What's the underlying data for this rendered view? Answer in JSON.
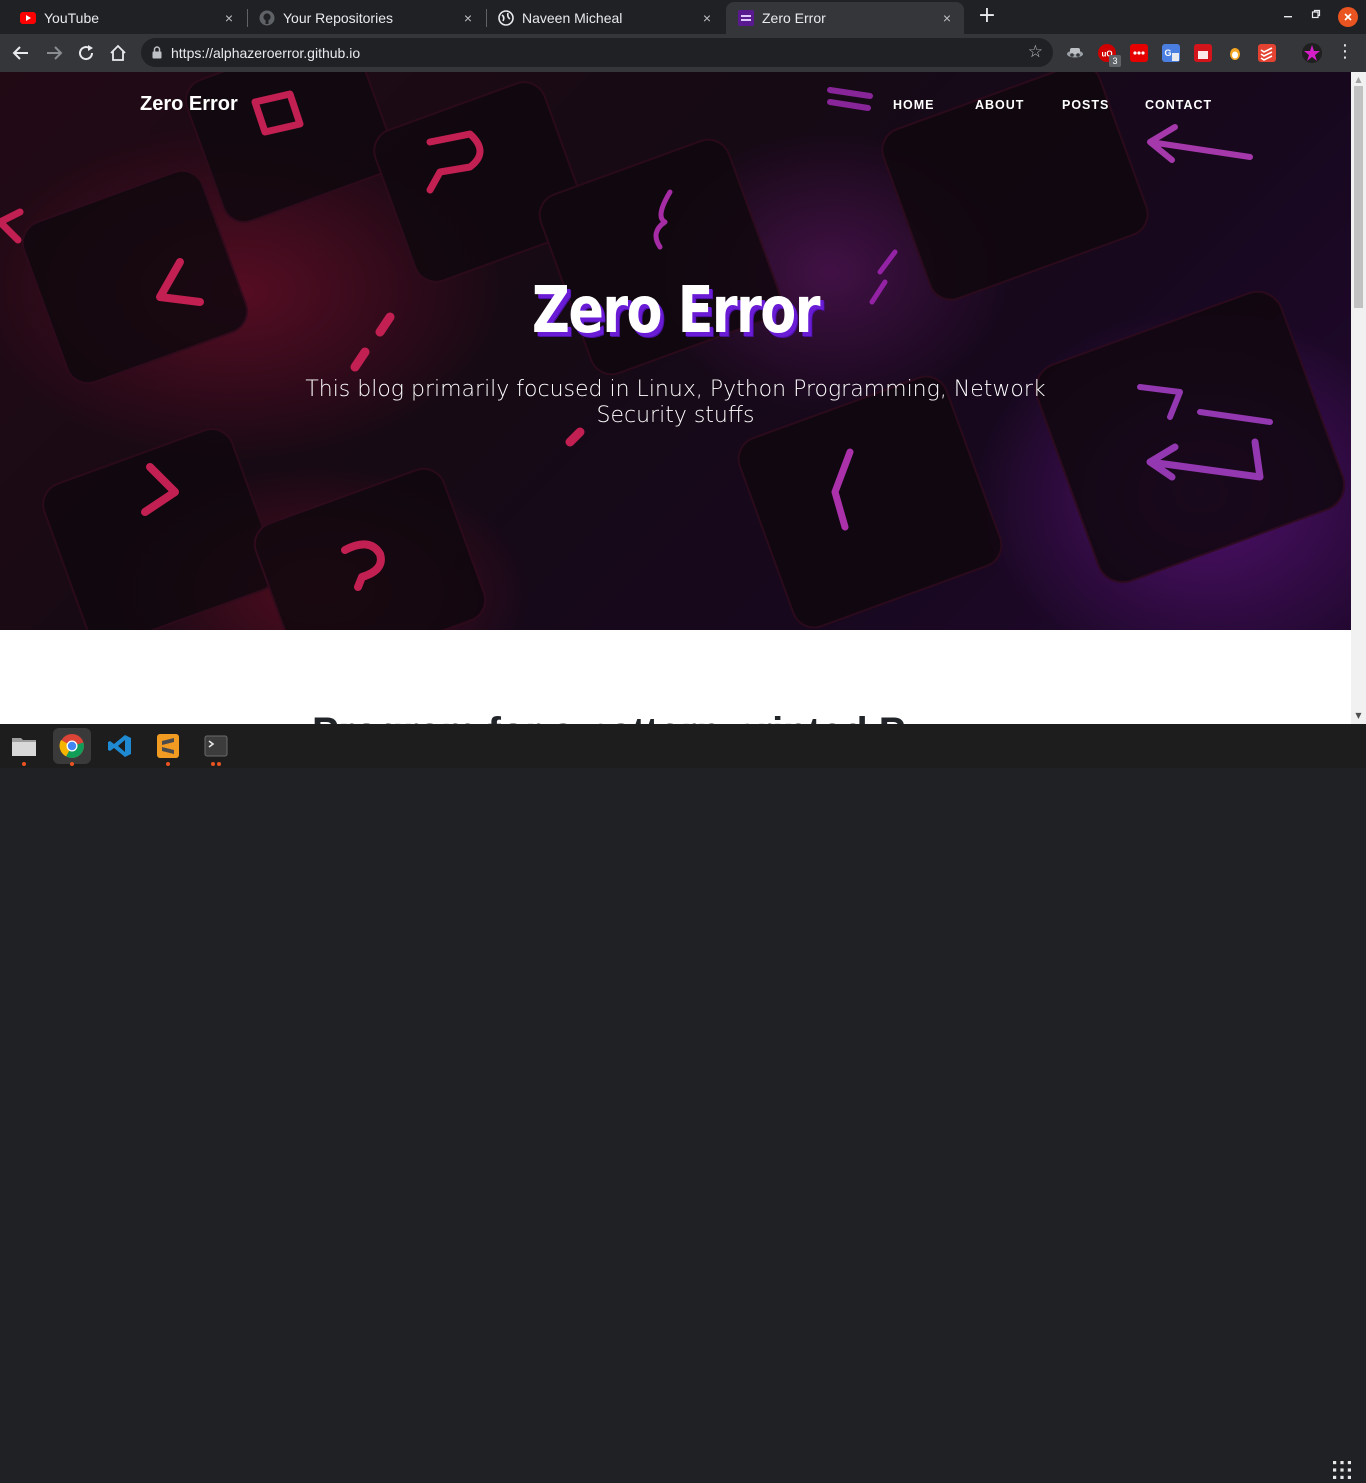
{
  "browser": {
    "tabs": [
      {
        "title": "YouTube",
        "icon": "youtube-icon",
        "active": false
      },
      {
        "title": "Your Repositories",
        "icon": "github-icon",
        "active": false
      },
      {
        "title": "Naveen Micheal",
        "icon": "globe-icon",
        "active": false
      },
      {
        "title": "Zero Error",
        "icon": "site-favicon",
        "active": true
      }
    ],
    "close_glyph": "×",
    "new_tab_glyph": "+",
    "address": "https://alphazeroerror.github.io",
    "extension_badge": "3",
    "colors": {
      "frame": "#202124",
      "toolbar": "#35363a",
      "close_window": "#e95420"
    }
  },
  "site": {
    "brand": "Zero Error",
    "nav": {
      "home": "HOME",
      "about": "ABOUT",
      "posts": "POSTS",
      "contact": "CONTACT"
    },
    "heading": "Zero Error",
    "subheading": "This blog primarily focused in Linux, Python Programming, Network Security stuffs",
    "content_heading_partial": "Program for a pattern printed P",
    "colors": {
      "heading_shadow": "#6a1bd6",
      "hero_accent_red": "#dc1446",
      "hero_accent_purple": "#a01edc"
    }
  },
  "dock": {
    "items": [
      "files-icon",
      "chrome-icon",
      "vscode-icon",
      "sublime-text-icon",
      "terminal-icon"
    ],
    "apps_button": "show-applications-icon"
  }
}
